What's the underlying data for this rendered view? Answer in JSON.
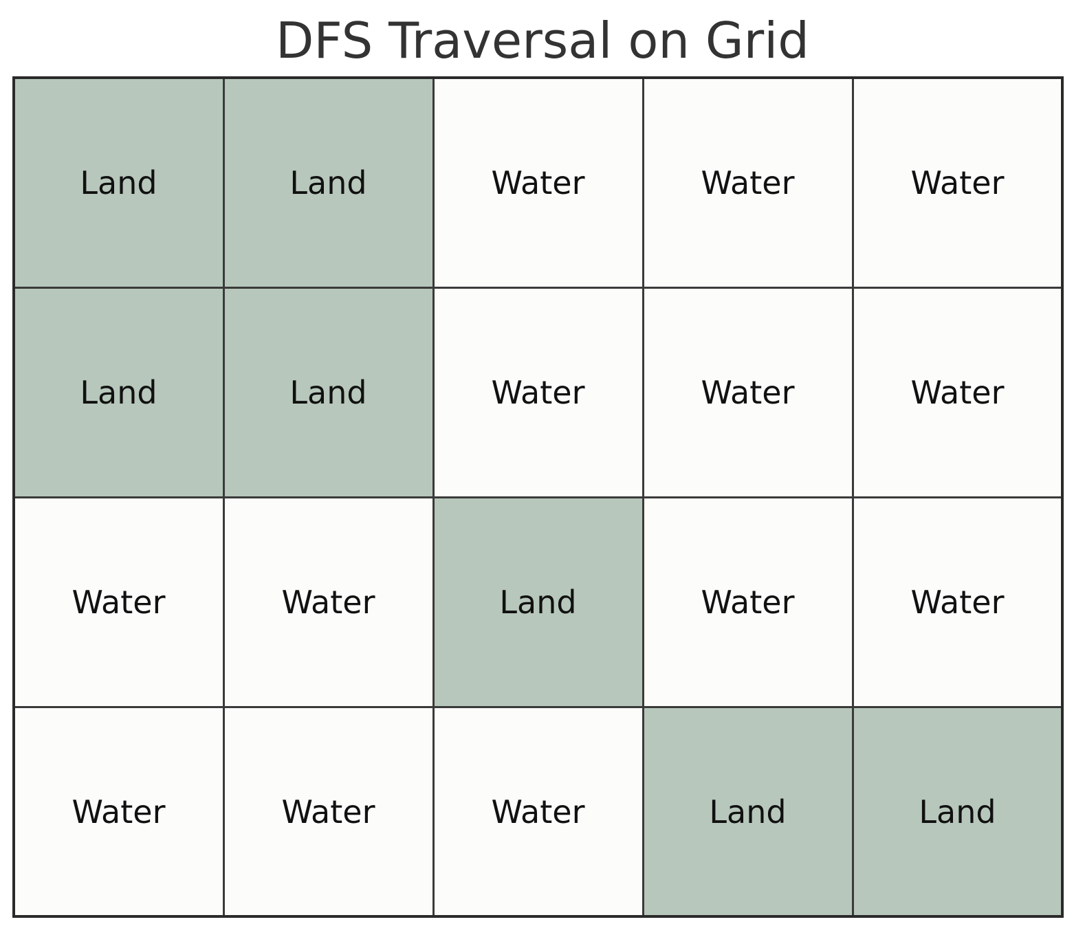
{
  "title": "DFS Traversal on Grid",
  "colors": {
    "land": "#b7c7bb",
    "water": "#fcfcfa",
    "border": "#3a3a3a",
    "title": "#333333"
  },
  "grid": {
    "rows": 4,
    "cols": 5,
    "cells": [
      [
        "Land",
        "Land",
        "Water",
        "Water",
        "Water"
      ],
      [
        "Land",
        "Land",
        "Water",
        "Water",
        "Water"
      ],
      [
        "Water",
        "Water",
        "Land",
        "Water",
        "Water"
      ],
      [
        "Water",
        "Water",
        "Water",
        "Land",
        "Land"
      ]
    ]
  }
}
